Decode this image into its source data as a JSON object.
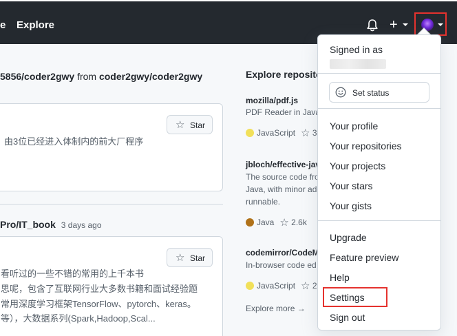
{
  "header": {
    "nav_partial": "e",
    "explore_label": "Explore",
    "plus_label": "+",
    "icons": [
      "bell-icon",
      "plus-icon",
      "avatar",
      "chevron-down-icon"
    ]
  },
  "feed": {
    "heading_prefix": "5856/coder2gwy",
    "heading_from": "from",
    "heading_repo": "coder2gwy/coder2gwy",
    "card1": {
      "star_label": "Star",
      "text": "由3位已经进入体制内的前大厂程序"
    },
    "event2": {
      "repo": "Pro/IT_book",
      "time": "3 days ago"
    },
    "card2": {
      "star_label": "Star",
      "lines": [
        "看听过的一些不错的常用的上千本书",
        "思呢，包含了互联网行业大多数书籍和面试经验题",
        "常用深度学习框架TensorFlow、pytorch、keras。",
        "等），大数据系列(Spark,Hadoop,Scal..."
      ]
    }
  },
  "explore": {
    "title": "Explore reposito",
    "repos": [
      {
        "name": "mozilla/pdf.js",
        "desc": [
          "PDF Reader in JavaS"
        ],
        "language": "JavaScript",
        "lang_color": "#f1e05a",
        "stars": "3"
      },
      {
        "name": "jbloch/effective-jav",
        "desc": [
          "The source code fro",
          "Java, with minor ado",
          "runnable."
        ],
        "language": "Java",
        "lang_color": "#b07219",
        "stars": "2.6k"
      },
      {
        "name": "codemirror/CodeM",
        "desc": [
          "In-browser code ed"
        ],
        "language": "JavaScript",
        "lang_color": "#f1e05a",
        "stars": "2"
      }
    ],
    "explore_more": "Explore more →"
  },
  "dropdown": {
    "signed_in_as": "Signed in as",
    "set_status": "Set status",
    "group1": [
      "Your profile",
      "Your repositories",
      "Your projects",
      "Your stars",
      "Your gists"
    ],
    "group2": [
      "Upgrade",
      "Feature preview",
      "Help",
      "Settings",
      "Sign out"
    ]
  },
  "colors": {
    "header_bg": "#24292f",
    "highlight_border": "#e5322e",
    "javascript": "#f1e05a",
    "java": "#b07219"
  }
}
